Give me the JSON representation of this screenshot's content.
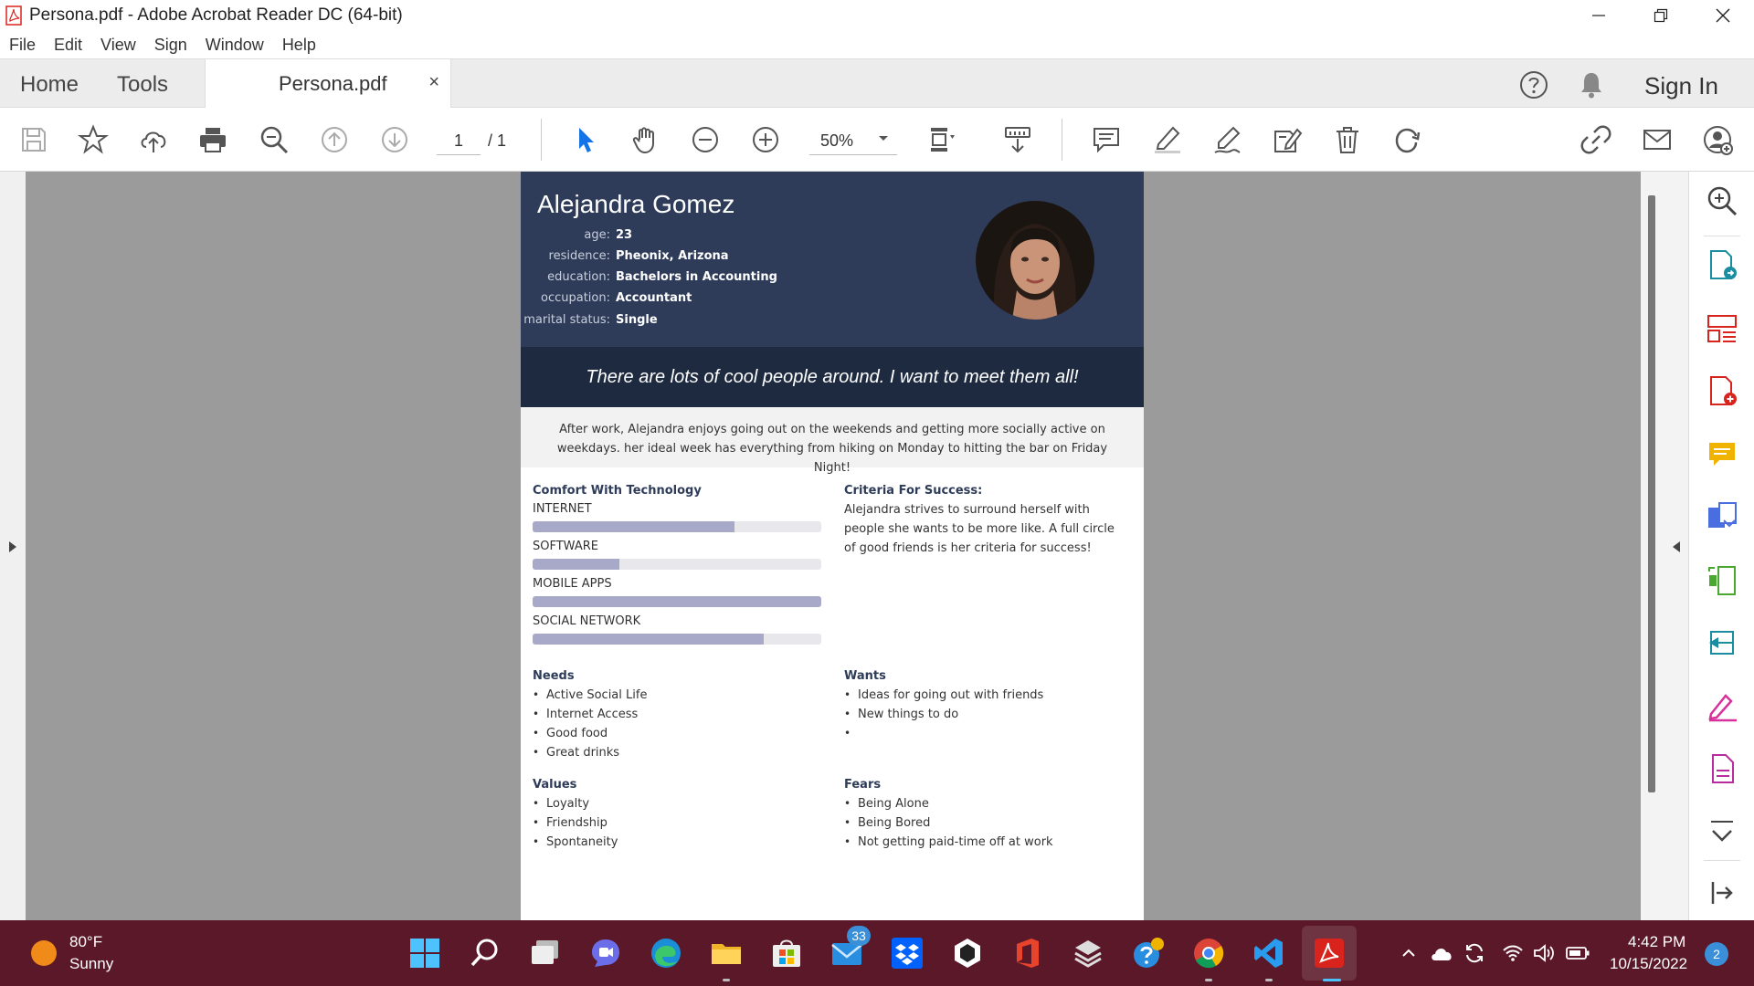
{
  "window": {
    "title": "Persona.pdf - Adobe Acrobat Reader DC (64-bit)"
  },
  "menu": [
    "File",
    "Edit",
    "View",
    "Sign",
    "Window",
    "Help"
  ],
  "tabs": {
    "home": "Home",
    "tools": "Tools",
    "document": "Persona.pdf",
    "close_glyph": "×",
    "sign_in": "Sign In"
  },
  "toolbar": {
    "page_current": "1",
    "page_total": "/ 1",
    "zoom": "50%"
  },
  "persona": {
    "name": "Alejandra Gomez",
    "fields": [
      {
        "label": "age:",
        "value": "23"
      },
      {
        "label": "residence:",
        "value": "Pheonix, Arizona"
      },
      {
        "label": "education:",
        "value": "Bachelors in Accounting"
      },
      {
        "label": "occupation:",
        "value": "Accountant"
      },
      {
        "label": "marital status:",
        "value": "Single"
      }
    ],
    "quote": "There are lots of cool people around. I want to meet them all!",
    "bio": "After work, Alejandra enjoys going out on the weekends and getting more socially active on weekdays. her ideal week has everything from hiking on Monday to hitting the bar on Friday Night!",
    "comfort_title": "Comfort With Technology",
    "skills": [
      {
        "label": "INTERNET",
        "level": 0.7
      },
      {
        "label": "SOFTWARE",
        "level": 0.3
      },
      {
        "label": "MOBILE APPS",
        "level": 1.0
      },
      {
        "label": "SOCIAL NETWORK",
        "level": 0.8
      }
    ],
    "criteria_title": "Criteria For Success:",
    "criteria_text": "Alejandra strives to surround herself with people she wants to be more like. A full circle of good friends is her criteria for success!",
    "needs_title": "Needs",
    "needs": [
      "Active Social Life",
      "Internet Access",
      "Good food",
      "Great drinks"
    ],
    "wants_title": "Wants",
    "wants": [
      "Ideas for going out with friends",
      "New things to do",
      ""
    ],
    "values_title": "Values",
    "values": [
      "Loyalty",
      "Friendship",
      "Spontaneity"
    ],
    "fears_title": "Fears",
    "fears": [
      "Being Alone",
      "Being Bored",
      "Not getting paid-time off at work"
    ]
  },
  "taskbar": {
    "weather_temp": "80°F",
    "weather_desc": "Sunny",
    "mail_badge": "33",
    "time": "4:42 PM",
    "date": "10/15/2022",
    "notifications": "2"
  },
  "colors": {
    "header": "#2e3c5a",
    "quote_bar": "#1e2a40",
    "skill_fill": "#a8a8c8",
    "taskbar": "#5a1828",
    "acrobat_red": "#d8241c"
  },
  "icons": [
    "save-icon",
    "bookmark-star-icon",
    "upload-cloud-icon",
    "print-icon",
    "search-zoom-icon",
    "page-up-icon",
    "page-down-icon",
    "select-arrow-icon",
    "hand-icon",
    "zoom-out-icon",
    "zoom-in-icon",
    "fit-page-icon",
    "scroll-mode-icon",
    "comment-icon",
    "highlight-icon",
    "draw-icon",
    "edit-text-icon",
    "delete-icon",
    "rotate-icon",
    "share-link-icon",
    "email-icon",
    "add-user-icon"
  ]
}
